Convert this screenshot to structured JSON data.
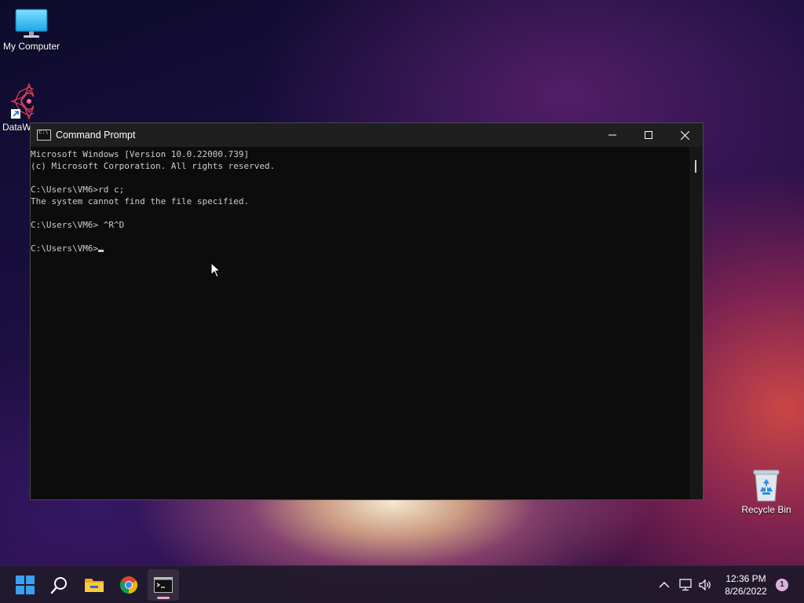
{
  "desktop": {
    "icons": [
      {
        "label": "My Computer",
        "icon": "monitor-icon"
      },
      {
        "label": "DataW",
        "icon": "datawrapper-icon"
      },
      {
        "label": "Recycle Bin",
        "icon": "recycle-bin-icon"
      }
    ]
  },
  "window": {
    "title": "Command Prompt",
    "icon": "cmd-icon",
    "controls": {
      "minimize": "minimize-icon",
      "maximize": "maximize-icon",
      "close": "close-icon"
    },
    "console_lines": [
      "Microsoft Windows [Version 10.0.22000.739]",
      "(c) Microsoft Corporation. All rights reserved.",
      "",
      "C:\\Users\\VM6>rd c;",
      "The system cannot find the file specified.",
      "",
      "C:\\Users\\VM6> ^R^D",
      "",
      "C:\\Users\\VM6>"
    ]
  },
  "taskbar": {
    "apps": [
      {
        "name": "Start",
        "icon": "windows-start-icon"
      },
      {
        "name": "Search",
        "icon": "search-icon"
      },
      {
        "name": "File Explorer",
        "icon": "folder-icon"
      },
      {
        "name": "Google Chrome",
        "icon": "chrome-icon"
      },
      {
        "name": "Command Prompt",
        "icon": "terminal-icon",
        "active": true
      }
    ],
    "tray": {
      "icons": [
        "chevron-up-icon",
        "network-icon",
        "volume-icon"
      ],
      "time": "12:36 PM",
      "date": "8/26/2022",
      "notification_count": "1"
    }
  },
  "colors": {
    "console_bg": "#0c0c0c",
    "console_text": "#cccccc",
    "titlebar_bg": "#1f1f1f",
    "taskbar_bg": "#201a2a",
    "active_indicator": "#e9a8d0"
  }
}
